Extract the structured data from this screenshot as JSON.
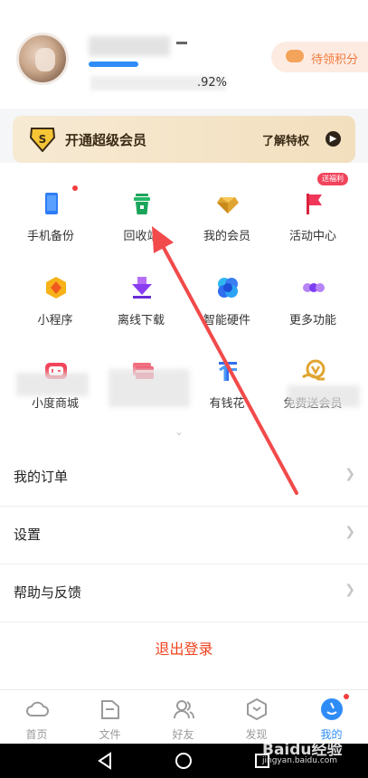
{
  "profile": {
    "percent_text": ".92%",
    "points_label": "待领积分"
  },
  "vip_banner": {
    "title": "开通超级会员",
    "action": "了解特权"
  },
  "features": {
    "row1": [
      {
        "label": "手机备份",
        "icon": "phone-backup-icon"
      },
      {
        "label": "回收站",
        "icon": "recycle-bin-icon"
      },
      {
        "label": "我的会员",
        "icon": "diamond-icon"
      },
      {
        "label": "活动中心",
        "icon": "flag-icon"
      }
    ],
    "row2": [
      {
        "label": "小程序",
        "icon": "mini-program-icon"
      },
      {
        "label": "离线下载",
        "icon": "offline-download-icon"
      },
      {
        "label": "智能硬件",
        "icon": "smart-hardware-icon"
      },
      {
        "label": "更多功能",
        "icon": "more-features-icon"
      }
    ],
    "row3": [
      {
        "label": "小度商城",
        "icon": "store-icon"
      },
      {
        "label": "",
        "icon": "card-icon"
      },
      {
        "label": "有钱花",
        "icon": "money-icon"
      },
      {
        "label": "免费送会员",
        "icon": "gift-member-icon"
      }
    ],
    "badge": "送福利"
  },
  "menu": {
    "orders": "我的订单",
    "settings": "设置",
    "help": "帮助与反馈",
    "logout": "退出登录"
  },
  "tabbar": [
    {
      "label": "首页",
      "icon": "cloud-icon"
    },
    {
      "label": "文件",
      "icon": "folder-icon"
    },
    {
      "label": "好友",
      "icon": "friends-icon"
    },
    {
      "label": "发现",
      "icon": "discover-icon"
    },
    {
      "label": "我的",
      "icon": "profile-icon"
    }
  ],
  "watermark": {
    "brand": "Baidu经验",
    "url": "jingyan.baidu.com"
  },
  "colors": {
    "accent": "#2f8cf7",
    "logout": "#f0421c",
    "annotation_arrow": "#f24a4a"
  }
}
